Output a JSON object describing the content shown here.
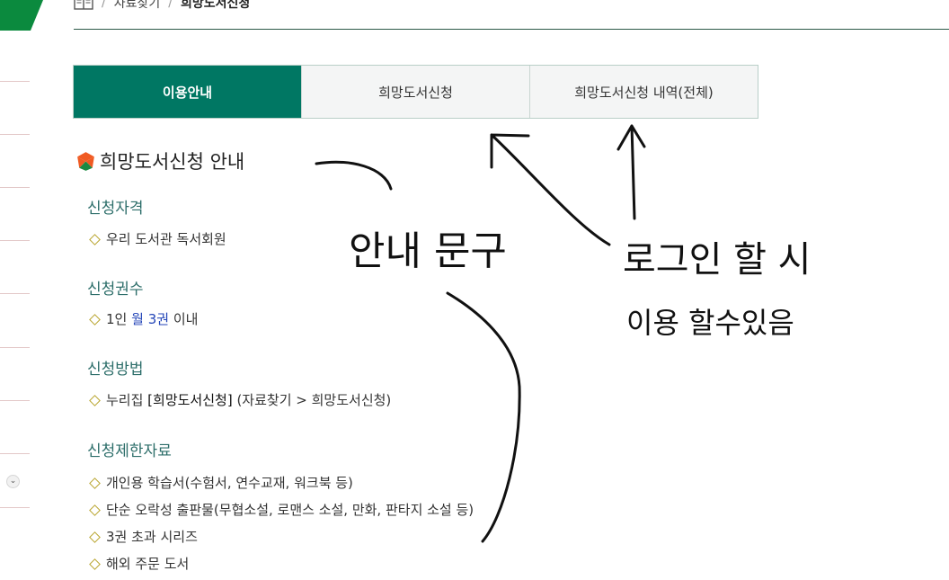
{
  "colors": {
    "accent": "#007763",
    "green_corner": "#0b8a3e",
    "star_orange": "#f05a22",
    "star_green": "#1a8a42",
    "link_blue": "#2446b8",
    "heading_teal": "#2d6e6a"
  },
  "breadcrumb": {
    "icon": "book-icon",
    "items": [
      "자료찾기",
      "희망도서신청"
    ],
    "separator": "/"
  },
  "tabs": [
    {
      "label": "이용안내",
      "active": true
    },
    {
      "label": "희망도서신청",
      "active": false
    },
    {
      "label": "희망도서신청 내역(전체)",
      "active": false
    }
  ],
  "section": {
    "title": "희망도서신청 안내",
    "icon": "star-icon"
  },
  "groups": [
    {
      "heading": "신청자격",
      "items": [
        "우리 도서관 독서회원"
      ]
    },
    {
      "heading": "신청권수",
      "item_parts": {
        "pre": "1인 ",
        "highlight": "월 3권",
        "post": " 이내"
      }
    },
    {
      "heading": "신청방법",
      "item_parts": {
        "pre": "누리집 ",
        "strong": "[희망도서신청]",
        "post": " (자료찾기 > 희망도서신청)"
      }
    },
    {
      "heading": "신청제한자료",
      "items": [
        "개인용 학습서(수험서, 연수교재, 워크북 등)",
        "단순 오락성 출판물(무협소설, 로맨스 소설, 만화, 판타지 소설 등)",
        "3권 초과 시리즈",
        "해외 주문 도서"
      ]
    }
  ],
  "sidebar": {
    "toggle_icon": "chevron-down-icon",
    "toggle_glyph": "⌄"
  },
  "annotations": {
    "guide": "안내 문구",
    "login_line1": "로그인 할 시",
    "login_line2": "이용 할수있음"
  }
}
